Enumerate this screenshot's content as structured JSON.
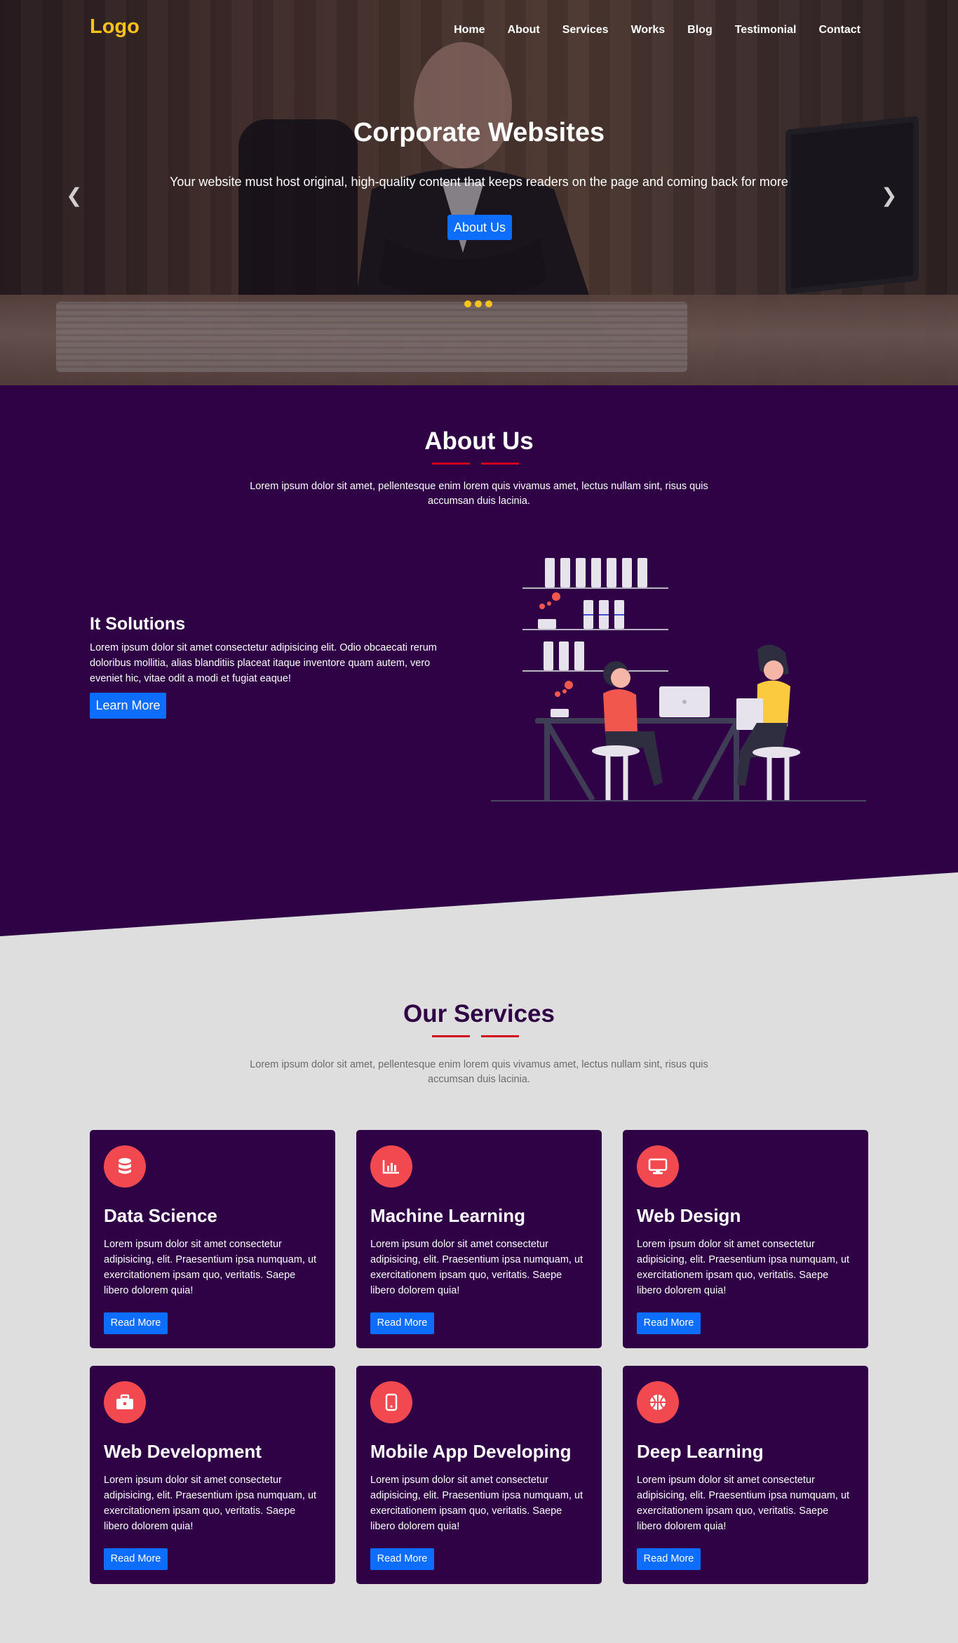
{
  "nav": {
    "logo": "Logo",
    "items": [
      "Home",
      "About",
      "Services",
      "Works",
      "Blog",
      "Testimonial",
      "Contact"
    ]
  },
  "hero": {
    "title": "Corporate Websites",
    "subtitle": "Your website must host original, high-quality content that keeps readers on the page and coming back for more",
    "button": "About Us",
    "slides": 3
  },
  "about": {
    "title": "About Us",
    "description": "Lorem ipsum dolor sit amet, pellentesque enim lorem quis vivamus amet, lectus nullam sint, risus quis accumsan duis lacinia.",
    "feature_title": "It Solutions",
    "feature_text": "Lorem ipsum dolor sit amet consectetur adipisicing elit. Odio obcaecati rerum doloribus mollitia, alias blanditiis placeat itaque inventore quam autem, vero eveniet hic, vitae odit a modi et fugiat eaque!",
    "feature_button": "Learn More"
  },
  "services": {
    "title": "Our Services",
    "description": "Lorem ipsum dolor sit amet, pellentesque enim lorem quis vivamus amet, lectus nullam sint, risus quis accumsan duis lacinia.",
    "cards": [
      {
        "title": "Data Science",
        "icon": "database-icon",
        "text": "Lorem ipsum dolor sit amet consectetur adipisicing, elit. Praesentium ipsa numquam, ut exercitationem ipsam quo, veritatis. Saepe libero dolorem quia!",
        "button": "Read More"
      },
      {
        "title": "Machine Learning",
        "icon": "chart-bar-icon",
        "text": "Lorem ipsum dolor sit amet consectetur adipisicing, elit. Praesentium ipsa numquam, ut exercitationem ipsam quo, veritatis. Saepe libero dolorem quia!",
        "button": "Read More"
      },
      {
        "title": "Web Design",
        "icon": "desktop-icon",
        "text": "Lorem ipsum dolor sit amet consectetur adipisicing, elit. Praesentium ipsa numquam, ut exercitationem ipsam quo, veritatis. Saepe libero dolorem quia!",
        "button": "Read More"
      },
      {
        "title": "Web Development",
        "icon": "briefcase-icon",
        "text": "Lorem ipsum dolor sit amet consectetur adipisicing, elit. Praesentium ipsa numquam, ut exercitationem ipsam quo, veritatis. Saepe libero dolorem quia!",
        "button": "Read More"
      },
      {
        "title": "Mobile App Developing",
        "icon": "mobile-icon",
        "text": "Lorem ipsum dolor sit amet consectetur adipisicing, elit. Praesentium ipsa numquam, ut exercitationem ipsam quo, veritatis. Saepe libero dolorem quia!",
        "button": "Read More"
      },
      {
        "title": "Deep Learning",
        "icon": "basketball-icon",
        "text": "Lorem ipsum dolor sit amet consectetur adipisicing, elit. Praesentium ipsa numquam, ut exercitationem ipsam quo, veritatis. Saepe libero dolorem quia!",
        "button": "Read More"
      }
    ]
  },
  "colors": {
    "brand_purple": "#2e0245",
    "accent_yellow": "#f7c21a",
    "button_blue": "#0d6efd",
    "icon_red": "#f1494f",
    "underline_red": "#d0021b",
    "page_gray": "#dedede"
  }
}
